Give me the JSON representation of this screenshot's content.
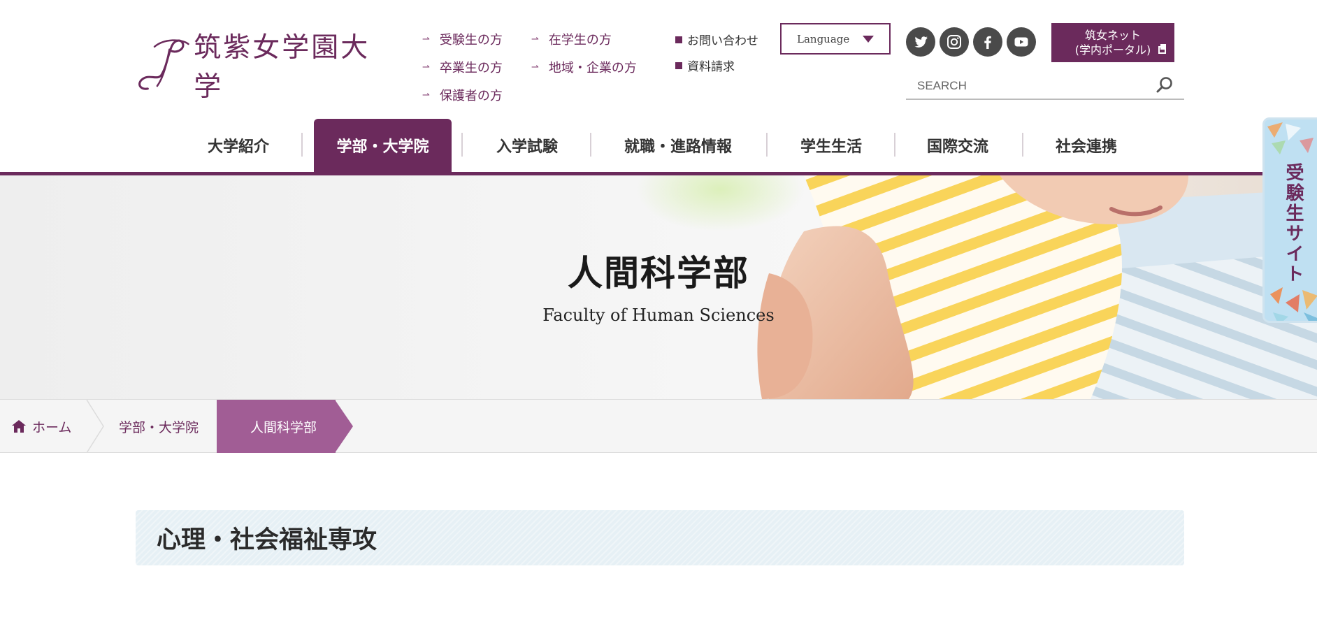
{
  "header": {
    "logo_text": "筑紫女学園大学",
    "target_links": [
      "受験生の方",
      "在学生の方",
      "卒業生の方",
      "地域・企業の方",
      "保護者の方"
    ],
    "utility_links": [
      "お問い合わせ",
      "資料請求"
    ],
    "language_label": "Language",
    "portal_line1": "筑女ネット",
    "portal_line2": "(学内ポータル)",
    "search_placeholder": "SEARCH",
    "socials": [
      "twitter-icon",
      "instagram-icon",
      "facebook-icon",
      "youtube-icon"
    ]
  },
  "nav": {
    "items": [
      "大学紹介",
      "学部・大学院",
      "入学試験",
      "就職・進路情報",
      "学生生活",
      "国際交流",
      "社会連携"
    ],
    "active_index": 1
  },
  "hero": {
    "title": "人間科学部",
    "subtitle": "Faculty of Human Sciences"
  },
  "side_tab": {
    "label": "受験生サイト"
  },
  "breadcrumb": {
    "items": [
      "ホーム",
      "学部・大学院",
      "人間科学部"
    ]
  },
  "section": {
    "heading": "心理・社会福祉専攻"
  },
  "colors": {
    "brand": "#6b2a5c",
    "crumb_current": "#a15d95",
    "heading_bg": "#e6f0f5"
  }
}
